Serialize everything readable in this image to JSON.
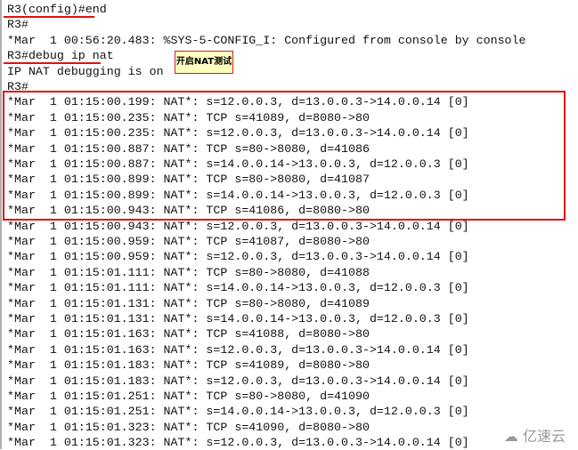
{
  "terminal": {
    "lines": [
      "R3(config)#end",
      "R3#",
      "*Mar  1 00:56:20.483: %SYS-5-CONFIG_I: Configured from console by console",
      "R3#debug ip nat",
      "IP NAT debugging is on",
      "R3#",
      "*Mar  1 01:15:00.199: NAT*: s=12.0.0.3, d=13.0.0.3->14.0.0.14 [0]",
      "*Mar  1 01:15:00.235: NAT*: TCP s=41089, d=8080->80",
      "*Mar  1 01:15:00.235: NAT*: s=12.0.0.3, d=13.0.0.3->14.0.0.14 [0]",
      "*Mar  1 01:15:00.887: NAT*: TCP s=80->8080, d=41086",
      "*Mar  1 01:15:00.887: NAT*: s=14.0.0.14->13.0.0.3, d=12.0.0.3 [0]",
      "*Mar  1 01:15:00.899: NAT*: TCP s=80->8080, d=41087",
      "*Mar  1 01:15:00.899: NAT*: s=14.0.0.14->13.0.0.3, d=12.0.0.3 [0]",
      "*Mar  1 01:15:00.943: NAT*: TCP s=41086, d=8080->80",
      "*Mar  1 01:15:00.943: NAT*: s=12.0.0.3, d=13.0.0.3->14.0.0.14 [0]",
      "*Mar  1 01:15:00.959: NAT*: TCP s=41087, d=8080->80",
      "*Mar  1 01:15:00.959: NAT*: s=12.0.0.3, d=13.0.0.3->14.0.0.14 [0]",
      "*Mar  1 01:15:01.111: NAT*: TCP s=80->8080, d=41088",
      "*Mar  1 01:15:01.111: NAT*: s=14.0.0.14->13.0.0.3, d=12.0.0.3 [0]",
      "*Mar  1 01:15:01.131: NAT*: TCP s=80->8080, d=41089",
      "*Mar  1 01:15:01.131: NAT*: s=14.0.0.14->13.0.0.3, d=12.0.0.3 [0]",
      "*Mar  1 01:15:01.163: NAT*: TCP s=41088, d=8080->80",
      "*Mar  1 01:15:01.163: NAT*: s=12.0.0.3, d=13.0.0.3->14.0.0.14 [0]",
      "*Mar  1 01:15:01.183: NAT*: TCP s=41089, d=8080->80",
      "*Mar  1 01:15:01.183: NAT*: s=12.0.0.3, d=13.0.0.3->14.0.0.14 [0]",
      "*Mar  1 01:15:01.251: NAT*: TCP s=80->8080, d=41090",
      "*Mar  1 01:15:01.251: NAT*: s=14.0.0.14->13.0.0.3, d=12.0.0.3 [0]",
      "*Mar  1 01:15:01.323: NAT*: TCP s=41090, d=8080->80",
      "*Mar  1 01:15:01.323: NAT*: s=12.0.0.3, d=13.0.0.3->14.0.0.14 [0]"
    ]
  },
  "annotation": {
    "note": "开启NAT测试",
    "highlight_color": "#e01010",
    "note_bg": "#ffffc0"
  },
  "watermark": "亿速云"
}
